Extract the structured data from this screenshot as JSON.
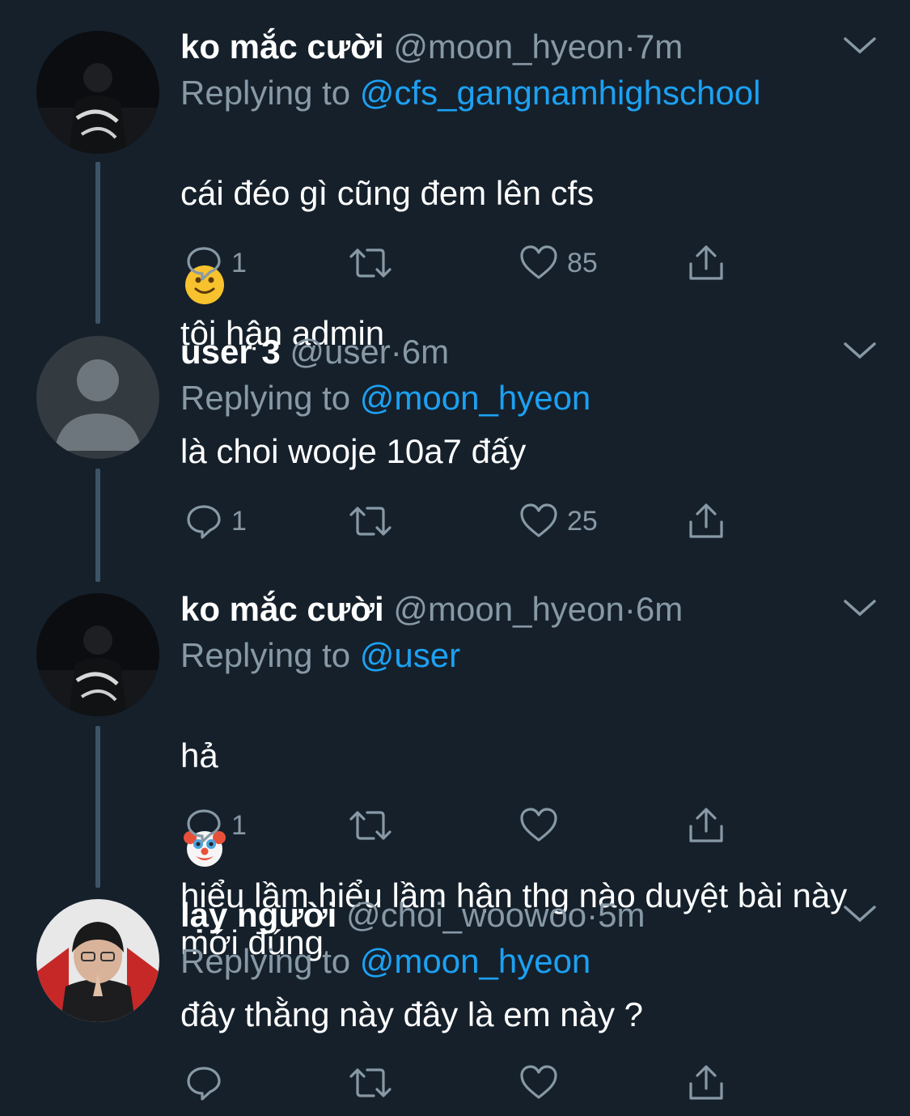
{
  "tweets": [
    {
      "display_name": "ko mắc cười",
      "handle": "@moon_hyeon",
      "dot": "·",
      "time": "7m",
      "replying_prefix": "Replying to",
      "replying_to": "@cfs_gangnamhighschool",
      "text_before": "cái đéo gì cũng đem lên cfs",
      "emoji": "slightly-smiling-face",
      "text_after": "tôi hận admin",
      "replies": "1",
      "likes": "85"
    },
    {
      "display_name": "user 3",
      "handle": "@user",
      "dot": "·",
      "time": "6m",
      "replying_prefix": "Replying to",
      "replying_to": "@moon_hyeon",
      "text": "là choi wooje 10a7 đấy",
      "replies": "1",
      "likes": "25"
    },
    {
      "display_name": "ko mắc cười",
      "handle": "@moon_hyeon",
      "dot": "·",
      "time": "6m",
      "replying_prefix": "Replying to",
      "replying_to": "@user",
      "text_before": "hả",
      "emoji": "clown-face",
      "text_after": "hiểu lầm hiểu lầm hận thg nào duyệt bài này mới đúng",
      "replies": "1",
      "likes": ""
    },
    {
      "display_name": "lạy người",
      "handle": "@choi_woowoo",
      "dot": "·",
      "time": "5m",
      "replying_prefix": "Replying to",
      "replying_to": "@moon_hyeon",
      "text": "đây thằng này đây là em này ?",
      "replies": "",
      "likes": ""
    }
  ],
  "colors": {
    "background": "#15202b",
    "secondary_text": "#8899a6",
    "link": "#1da1f2",
    "thread_line": "#3d5466"
  },
  "icons": [
    "reply-icon",
    "retweet-icon",
    "like-icon",
    "share-icon",
    "chevron-down-icon"
  ]
}
